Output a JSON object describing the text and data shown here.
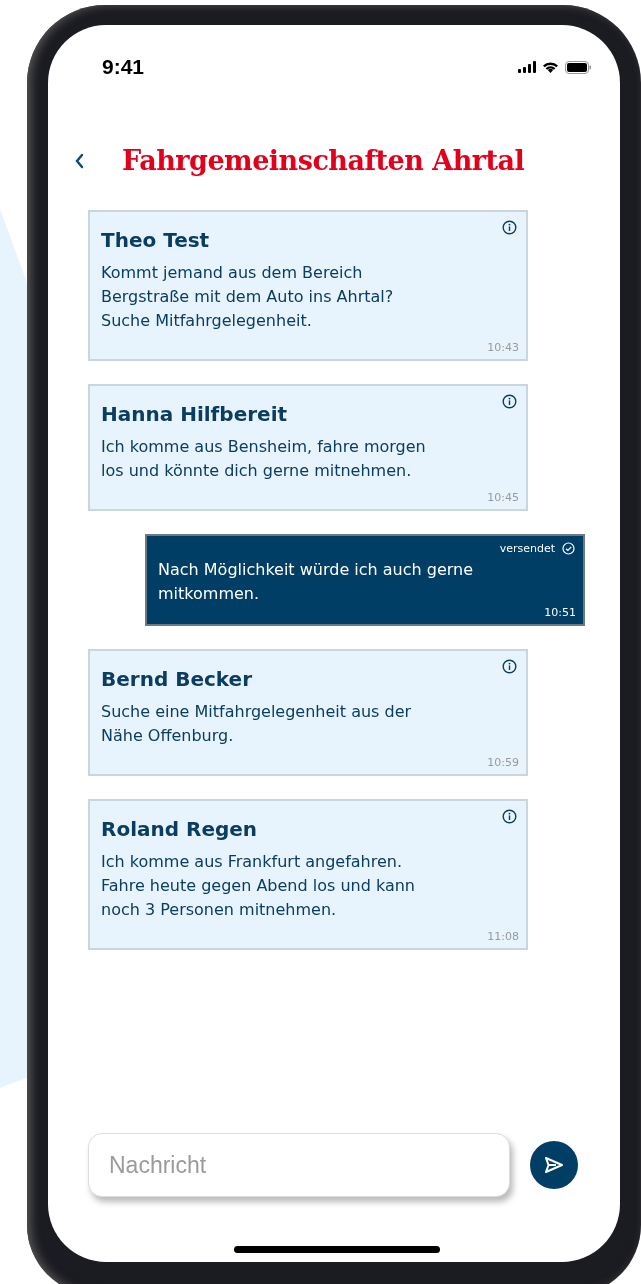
{
  "status_bar": {
    "time": "9:41"
  },
  "header": {
    "title": "Fahrgemeinschaften Ahrtal"
  },
  "messages": [
    {
      "kind": "incoming",
      "sender": "Theo Test",
      "text": "Kommt jemand aus dem Bereich Bergstraße mit dem Auto ins Ahrtal? Suche Mitfahrgelegenheit.",
      "time": "10:43"
    },
    {
      "kind": "incoming",
      "sender": "Hanna Hilfbereit",
      "text": "Ich komme aus Bensheim, fahre morgen los und könnte dich gerne mitnehmen.",
      "time": "10:45"
    },
    {
      "kind": "outgoing",
      "status": "versendet",
      "text": "Nach Möglichkeit würde ich auch gerne mitkommen.",
      "time": "10:51"
    },
    {
      "kind": "incoming",
      "sender": "Bernd Becker",
      "text": "Suche eine Mitfahrgelegenheit aus der Nähe Offenburg.",
      "time": "10:59"
    },
    {
      "kind": "incoming",
      "sender": "Roland Regen",
      "text": "Ich komme aus Frankfurt angefahren. Fahre heute gegen Abend los und kann noch 3 Personen mitnehmen.",
      "time": "11:08"
    }
  ],
  "composer": {
    "placeholder": "Nachricht"
  }
}
